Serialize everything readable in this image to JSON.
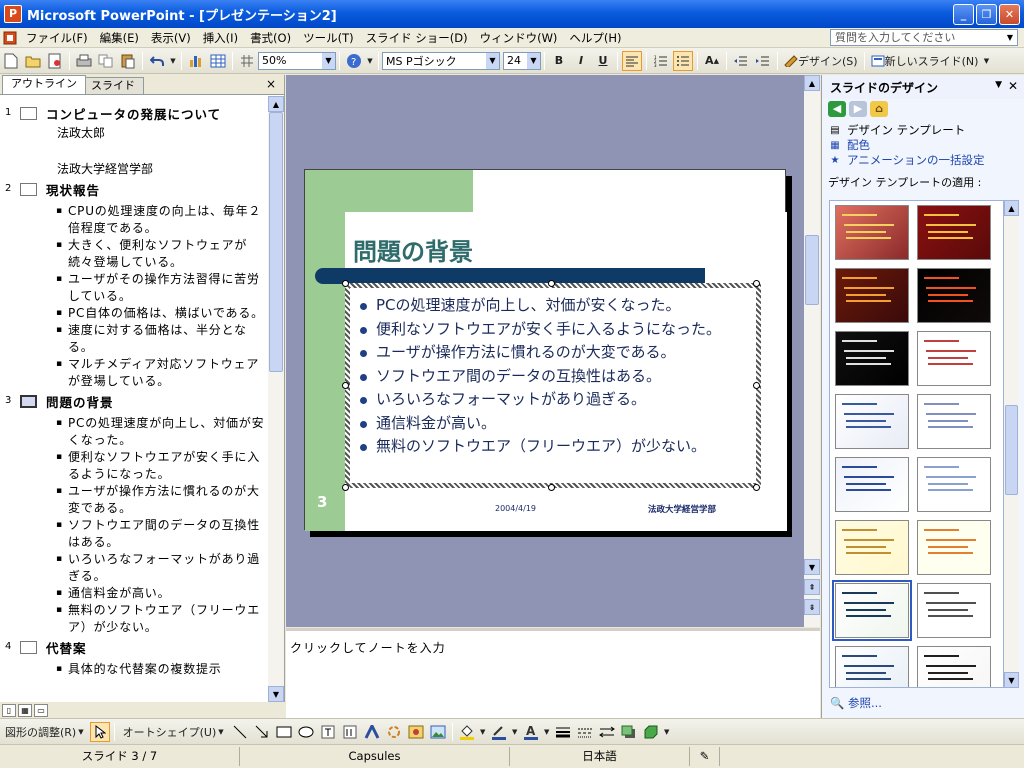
{
  "window": {
    "title": "Microsoft PowerPoint - [プレゼンテーション2]",
    "app_icon": "P"
  },
  "menu": {
    "items": [
      "ファイル(F)",
      "編集(E)",
      "表示(V)",
      "挿入(I)",
      "書式(O)",
      "ツール(T)",
      "スライド ショー(D)",
      "ウィンドウ(W)",
      "ヘルプ(H)"
    ],
    "help_placeholder": "質問を入力してください"
  },
  "toolbar": {
    "zoom": "50%",
    "font": "MS Pゴシック",
    "size": "24",
    "bold": "B",
    "italic": "I",
    "underline": "U",
    "design_label": "デザイン(S)",
    "new_slide_label": "新しいスライド(N)"
  },
  "left_pane": {
    "tabs": [
      "アウトライン",
      "スライド"
    ],
    "close": "×",
    "slides": [
      {
        "num": "1",
        "title": "コンピュータの発展について",
        "sub": [
          "法政太郎",
          "",
          "法政大学経営学部"
        ],
        "bullets": []
      },
      {
        "num": "2",
        "title": "現状報告",
        "sub": [],
        "bullets": [
          "CPUの処理速度の向上は、毎年２倍程度である。",
          "大きく、便利なソフトウェアが続々登場している。",
          "ユーザがその操作方法習得に苦労している。",
          "PC自体の価格は、横ばいである。",
          "速度に対する価格は、半分となる。",
          "マルチメディア対応ソフトウェアが登場している。"
        ]
      },
      {
        "num": "3",
        "title": "問題の背景",
        "sub": [],
        "bullets": [
          "PCの処理速度が向上し、対価が安くなった。",
          "便利なソフトウエアが安く手に入るようになった。",
          "ユーザが操作方法に慣れるのが大変である。",
          "ソフトウエア間のデータの互換性はある。",
          "いろいろなフォーマットがあり過ぎる。",
          "通信料金が高い。",
          "無料のソフトウエア（フリーウエア）が少ない。"
        ]
      },
      {
        "num": "4",
        "title": "代替案",
        "sub": [],
        "bullets": [
          "具体的な代替案の複数提示"
        ]
      }
    ]
  },
  "slide": {
    "title": "問題の背景",
    "bullets": [
      "PCの処理速度が向上し、対価が安くなった。",
      "便利なソフトウエアが安く手に入るようになった。",
      "ユーザが操作方法に慣れるのが大変である。",
      "ソフトウエア間のデータの互換性はある。",
      "いろいろなフォーマットがあり過ぎる。",
      "通信料金が高い。",
      "無料のソフトウエア（フリーウエア）が少ない。"
    ],
    "page_number": "3",
    "date": "2004/4/19",
    "footer": "法政大学経営学部"
  },
  "notes": {
    "placeholder": "クリックしてノートを入力"
  },
  "task_pane": {
    "title": "スライドのデザイン",
    "links": [
      "デザイン テンプレート",
      "配色",
      "アニメーションの一括設定"
    ],
    "apply_label": "デザイン テンプレートの適用 :",
    "browse": "参照..."
  },
  "drawing_toolbar": {
    "draw_label": "図形の調整(R)",
    "autoshape_label": "オートシェイプ(U)"
  },
  "status": {
    "slide": "スライド 3 / 7",
    "template": "Capsules",
    "language": "日本語"
  },
  "colors": {
    "accent": "#0A5CDE",
    "slide_green": "#9CCC94",
    "slide_navy": "#0F3A66",
    "title_teal": "#2E6B6B"
  }
}
